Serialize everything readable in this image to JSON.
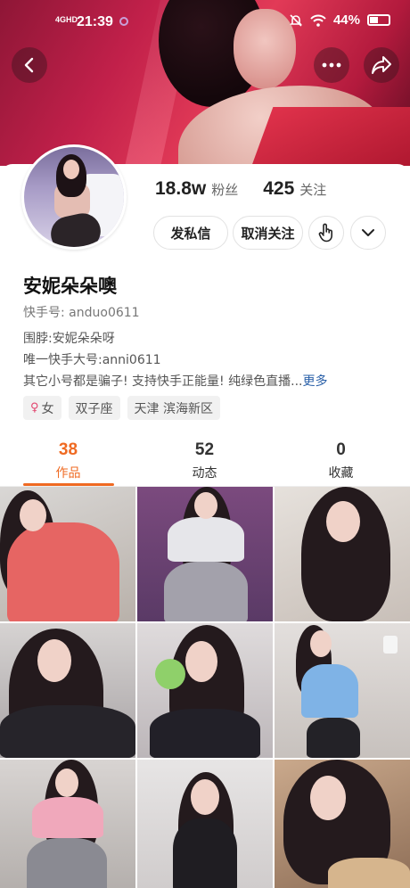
{
  "status_bar": {
    "network": "4GHD",
    "time": "21:39",
    "battery": "44%"
  },
  "nav": {
    "back_icon": "chevron-left-icon",
    "more_icon": "ellipsis-icon",
    "share_icon": "share-arrow-icon"
  },
  "profile": {
    "followers_count": "18.8w",
    "followers_label": "粉丝",
    "following_count": "425",
    "following_label": "关注",
    "message_button": "发私信",
    "unfollow_button": "取消关注",
    "name": "安妮朵朵噢",
    "kuaishou_id": "快手号: anduo0611",
    "bio": [
      "围脖:安妮朵朵呀",
      "唯一快手大号:anni0611",
      "其它小号都是骗子! 支持快手正能量!   纯绿色直播..."
    ],
    "bio_more": "更多",
    "tags": {
      "gender": "女",
      "zodiac": "双子座",
      "location": "天津 滨海新区"
    },
    "colors": {
      "accent": "#ef6a22",
      "link": "#2a60a8",
      "female_icon": "#e2456e"
    }
  },
  "tabs": [
    {
      "count": "38",
      "label": "作品",
      "active": true
    },
    {
      "count": "52",
      "label": "动态",
      "active": false
    },
    {
      "count": "0",
      "label": "收藏",
      "active": false
    }
  ]
}
